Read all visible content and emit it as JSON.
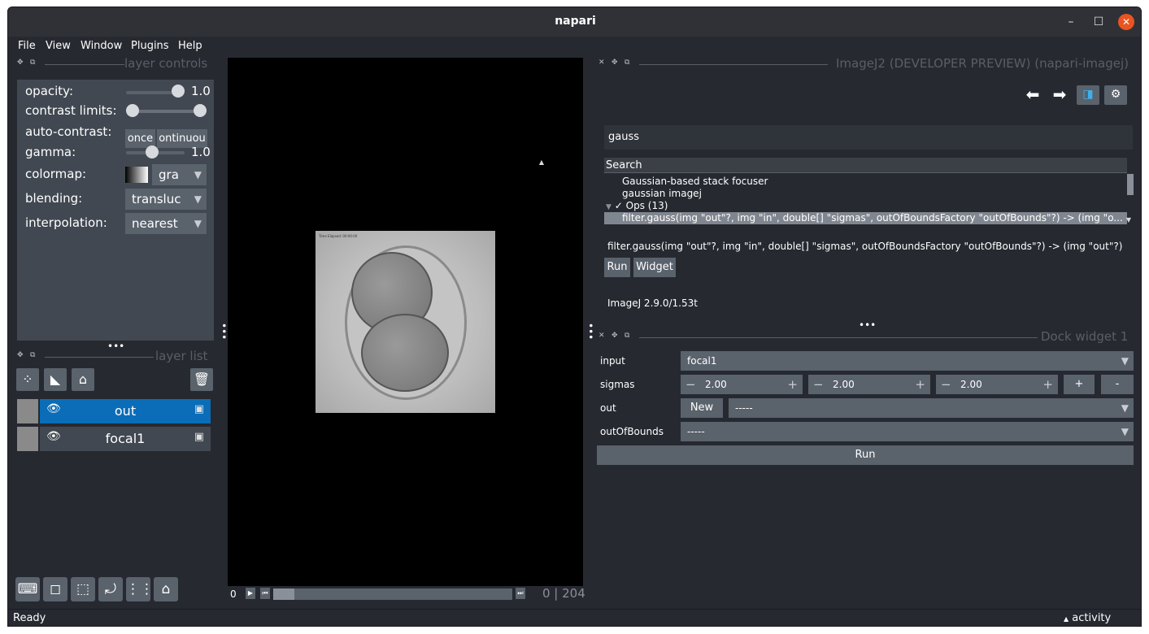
{
  "app": {
    "title": "napari"
  },
  "window_controls": {
    "minimize": "–",
    "maximize": "☐",
    "close": "✕"
  },
  "menu": [
    "File",
    "View",
    "Window",
    "Plugins",
    "Help"
  ],
  "layer_controls": {
    "title": "layer controls",
    "opacity_label": "opacity:",
    "opacity_value": "1.0",
    "opacity_level": 1.0,
    "contrast_label": "contrast limits:",
    "autocontrast_label": "auto-contrast:",
    "once": "once",
    "continuous": "ontinuou",
    "gamma_label": "gamma:",
    "gamma_value": "1.0",
    "colormap_label": "colormap:",
    "colormap_value": "gra",
    "blending_label": "blending:",
    "blending_value": "transluc",
    "interpolation_label": "interpolation:",
    "interpolation_value": "nearest"
  },
  "layer_list": {
    "title": "layer list",
    "layers": [
      {
        "name": "out",
        "selected": true
      },
      {
        "name": "focal1",
        "selected": false
      }
    ]
  },
  "canvas": {
    "frame_start": "0",
    "frame_readout": "0 | 204",
    "image_label": "Time Elapsed: 00:00:00"
  },
  "imagej_panel": {
    "title": "ImageJ2 (DEVELOPER PREVIEW) (napari-imagej)",
    "search_value": "gauss",
    "tree_header": "Search",
    "results": [
      "Gaussian-based stack focuser",
      "gaussian imagej"
    ],
    "ops_node": "Ops (13)",
    "selected_result": "filter.gauss(img \"out\"?, img \"in\", double[] \"sigmas\", outOfBoundsFactory \"outOfBounds\"?) -> (img \"o...",
    "signature": "filter.gauss(img \"out\"?, img \"in\", double[] \"sigmas\", outOfBoundsFactory \"outOfBounds\"?) -> (img \"out\"?)",
    "run": "Run",
    "widget": "Widget",
    "version": "ImageJ 2.9.0/1.53t"
  },
  "dock_widget": {
    "title": "Dock widget 1",
    "input_label": "input",
    "input_value": "focal1",
    "sigmas_label": "sigmas",
    "sigmas": [
      "2.00",
      "2.00",
      "2.00"
    ],
    "plus": "+",
    "minus": "-",
    "out_label": "out",
    "new_label": "New",
    "out_value": "-----",
    "oob_label": "outOfBounds",
    "oob_value": "-----",
    "run_label": "Run"
  },
  "status": {
    "text": "Ready",
    "activity": "activity"
  },
  "colors": {
    "background": "#262930",
    "panel": "#414851",
    "control": "#5a626c",
    "selected": "#0b6db7"
  }
}
